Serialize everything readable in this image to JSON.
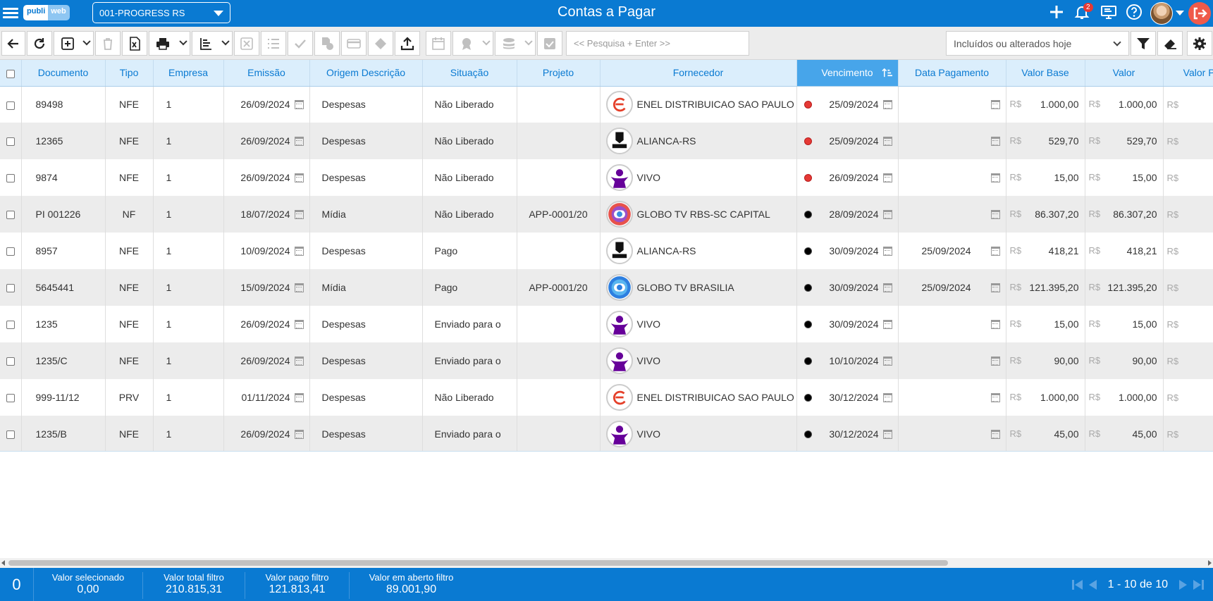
{
  "header": {
    "logo_left": "publi",
    "logo_right": "web",
    "company": "001-PROGRESS RS",
    "title": "Contas a Pagar",
    "notifications": "2"
  },
  "toolbar": {
    "search_placeholder": "<< Pesquisa + Enter >>",
    "filter_value": "Incluídos ou alterados hoje"
  },
  "columns": [
    "Documento",
    "Tipo",
    "Empresa",
    "Emissão",
    "Origem Descrição",
    "Situação",
    "Projeto",
    "Fornecedor",
    "Vencimento",
    "Data Pagamento",
    "Valor Base",
    "Valor",
    "Valor Pa"
  ],
  "currency": "R$",
  "rows": [
    {
      "doc": "89498",
      "tipo": "NFE",
      "empresa": "1",
      "emissao": "26/09/2024",
      "origem": "Despesas",
      "situacao": "Não Liberado",
      "projeto": "",
      "fornecedor": "ENEL DISTRIBUICAO SAO PAULO",
      "logo": "enel",
      "status": "red",
      "vencimento": "25/09/2024",
      "pagamento": "",
      "valor_base": "1.000,00",
      "valor": "1.000,00"
    },
    {
      "doc": "12365",
      "tipo": "NFE",
      "empresa": "1",
      "emissao": "26/09/2024",
      "origem": "Despesas",
      "situacao": "Não Liberado",
      "projeto": "",
      "fornecedor": "ALIANCA-RS",
      "logo": "alianca",
      "status": "red",
      "vencimento": "25/09/2024",
      "pagamento": "",
      "valor_base": "529,70",
      "valor": "529,70"
    },
    {
      "doc": "9874",
      "tipo": "NFE",
      "empresa": "1",
      "emissao": "26/09/2024",
      "origem": "Despesas",
      "situacao": "Não Liberado",
      "projeto": "",
      "fornecedor": "VIVO",
      "logo": "vivo",
      "status": "red",
      "vencimento": "26/09/2024",
      "pagamento": "",
      "valor_base": "15,00",
      "valor": "15,00"
    },
    {
      "doc": "PI 001226",
      "tipo": "NF",
      "empresa": "1",
      "emissao": "18/07/2024",
      "origem": "Mídia",
      "situacao": "Não Liberado",
      "projeto": "APP-0001/20",
      "fornecedor": "GLOBO TV RBS-SC CAPITAL",
      "logo": "globo",
      "status": "black",
      "vencimento": "28/09/2024",
      "pagamento": "",
      "valor_base": "86.307,20",
      "valor": "86.307,20"
    },
    {
      "doc": "8957",
      "tipo": "NFE",
      "empresa": "1",
      "emissao": "10/09/2024",
      "origem": "Despesas",
      "situacao": "Pago",
      "projeto": "",
      "fornecedor": "ALIANCA-RS",
      "logo": "alianca",
      "status": "black",
      "vencimento": "30/09/2024",
      "pagamento": "25/09/2024",
      "valor_base": "418,21",
      "valor": "418,21"
    },
    {
      "doc": "5645441",
      "tipo": "NFE",
      "empresa": "1",
      "emissao": "15/09/2024",
      "origem": "Mídia",
      "situacao": "Pago",
      "projeto": "APP-0001/20",
      "fornecedor": "GLOBO TV BRASILIA",
      "logo": "globo-blue",
      "status": "black",
      "vencimento": "30/09/2024",
      "pagamento": "25/09/2024",
      "valor_base": "121.395,20",
      "valor": "121.395,20"
    },
    {
      "doc": "1235",
      "tipo": "NFE",
      "empresa": "1",
      "emissao": "26/09/2024",
      "origem": "Despesas",
      "situacao": "Enviado para o",
      "projeto": "",
      "fornecedor": "VIVO",
      "logo": "vivo",
      "status": "black",
      "vencimento": "30/09/2024",
      "pagamento": "",
      "valor_base": "15,00",
      "valor": "15,00"
    },
    {
      "doc": "1235/C",
      "tipo": "NFE",
      "empresa": "1",
      "emissao": "26/09/2024",
      "origem": "Despesas",
      "situacao": "Enviado para o",
      "projeto": "",
      "fornecedor": "VIVO",
      "logo": "vivo",
      "status": "black",
      "vencimento": "10/10/2024",
      "pagamento": "",
      "valor_base": "90,00",
      "valor": "90,00"
    },
    {
      "doc": "999-11/12",
      "tipo": "PRV",
      "empresa": "1",
      "emissao": "01/11/2024",
      "origem": "Despesas",
      "situacao": "Não Liberado",
      "projeto": "",
      "fornecedor": "ENEL DISTRIBUICAO SAO PAULO",
      "logo": "enel",
      "status": "black",
      "vencimento": "30/12/2024",
      "pagamento": "",
      "valor_base": "1.000,00",
      "valor": "1.000,00"
    },
    {
      "doc": "1235/B",
      "tipo": "NFE",
      "empresa": "1",
      "emissao": "26/09/2024",
      "origem": "Despesas",
      "situacao": "Enviado para o",
      "projeto": "",
      "fornecedor": "VIVO",
      "logo": "vivo",
      "status": "black",
      "vencimento": "30/12/2024",
      "pagamento": "",
      "valor_base": "45,00",
      "valor": "45,00"
    }
  ],
  "footer": {
    "selected_count": "0",
    "stats": [
      {
        "label": "Valor selecionado",
        "value": "0,00"
      },
      {
        "label": "Valor total filtro",
        "value": "210.815,31"
      },
      {
        "label": "Valor pago filtro",
        "value": "121.813,41"
      },
      {
        "label": "Valor em aberto filtro",
        "value": "89.001,90"
      }
    ],
    "page_info": "1 - 10 de 10"
  },
  "colors": {
    "primary": "#0a7ad2",
    "header_bg": "#dbeefc",
    "sorted_header": "#47a5ea",
    "overdue": "#e53935"
  }
}
